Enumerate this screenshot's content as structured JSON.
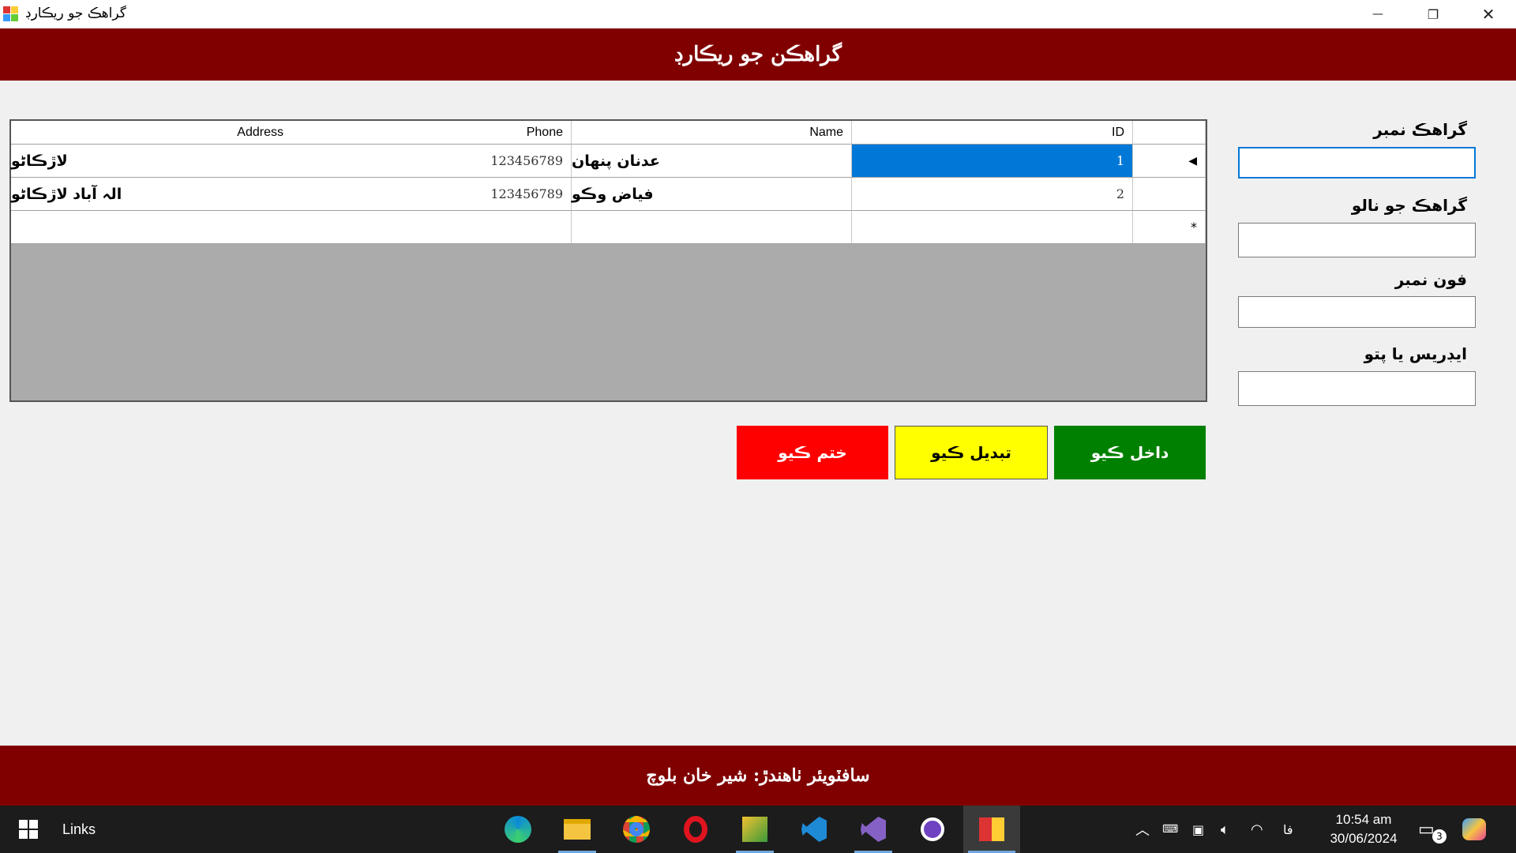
{
  "window": {
    "title": "گراهڪ جو ريڪارڊ",
    "minimize_glyph": "—",
    "restore_glyph": "❐",
    "close_glyph": "✕"
  },
  "header": {
    "title": "گراهڪن جو ريڪارڊ"
  },
  "grid": {
    "columns": [
      "ID",
      "Name",
      "Phone",
      "Address"
    ],
    "rows": [
      {
        "indicator": "◀",
        "id": "1",
        "name": "عدنان پنهان",
        "phone": "123456789",
        "address": "لاڙڪاڻو"
      },
      {
        "indicator": "",
        "id": "2",
        "name": "فياض وڪو",
        "phone": "123456789",
        "address": "الہ آباد لاڙڪاڻو"
      }
    ],
    "new_row_indicator": "*"
  },
  "form": {
    "customer_number_label": "گراهڪ نمبر",
    "customer_number_value": "",
    "customer_name_label": "گراهڪ جو نالو",
    "customer_name_value": "",
    "phone_label": "فون نمبر",
    "phone_value": "",
    "address_label": "ايڊريس يا پتو",
    "address_value": ""
  },
  "buttons": {
    "insert_label": "داخل ڪيو",
    "update_label": "تبديل ڪيو",
    "delete_label": "ختم ڪيو",
    "insert_color": "#008000",
    "update_color": "#ffff00",
    "delete_color": "#ff0000"
  },
  "footer": {
    "text": "سافٽويئر ٺاهندڙ: شير خان بلوچ"
  },
  "taskbar": {
    "search_label": "Links",
    "apps": [
      "edge-icon",
      "file-explorer-icon",
      "chrome-icon",
      "opera-icon",
      "sql-icon",
      "vscode-icon",
      "visual-studio-icon",
      "github-desktop-icon",
      "app-icon"
    ],
    "language": "فا",
    "time": "10:54 am",
    "date": "30/06/2024",
    "notification_count": "3"
  }
}
